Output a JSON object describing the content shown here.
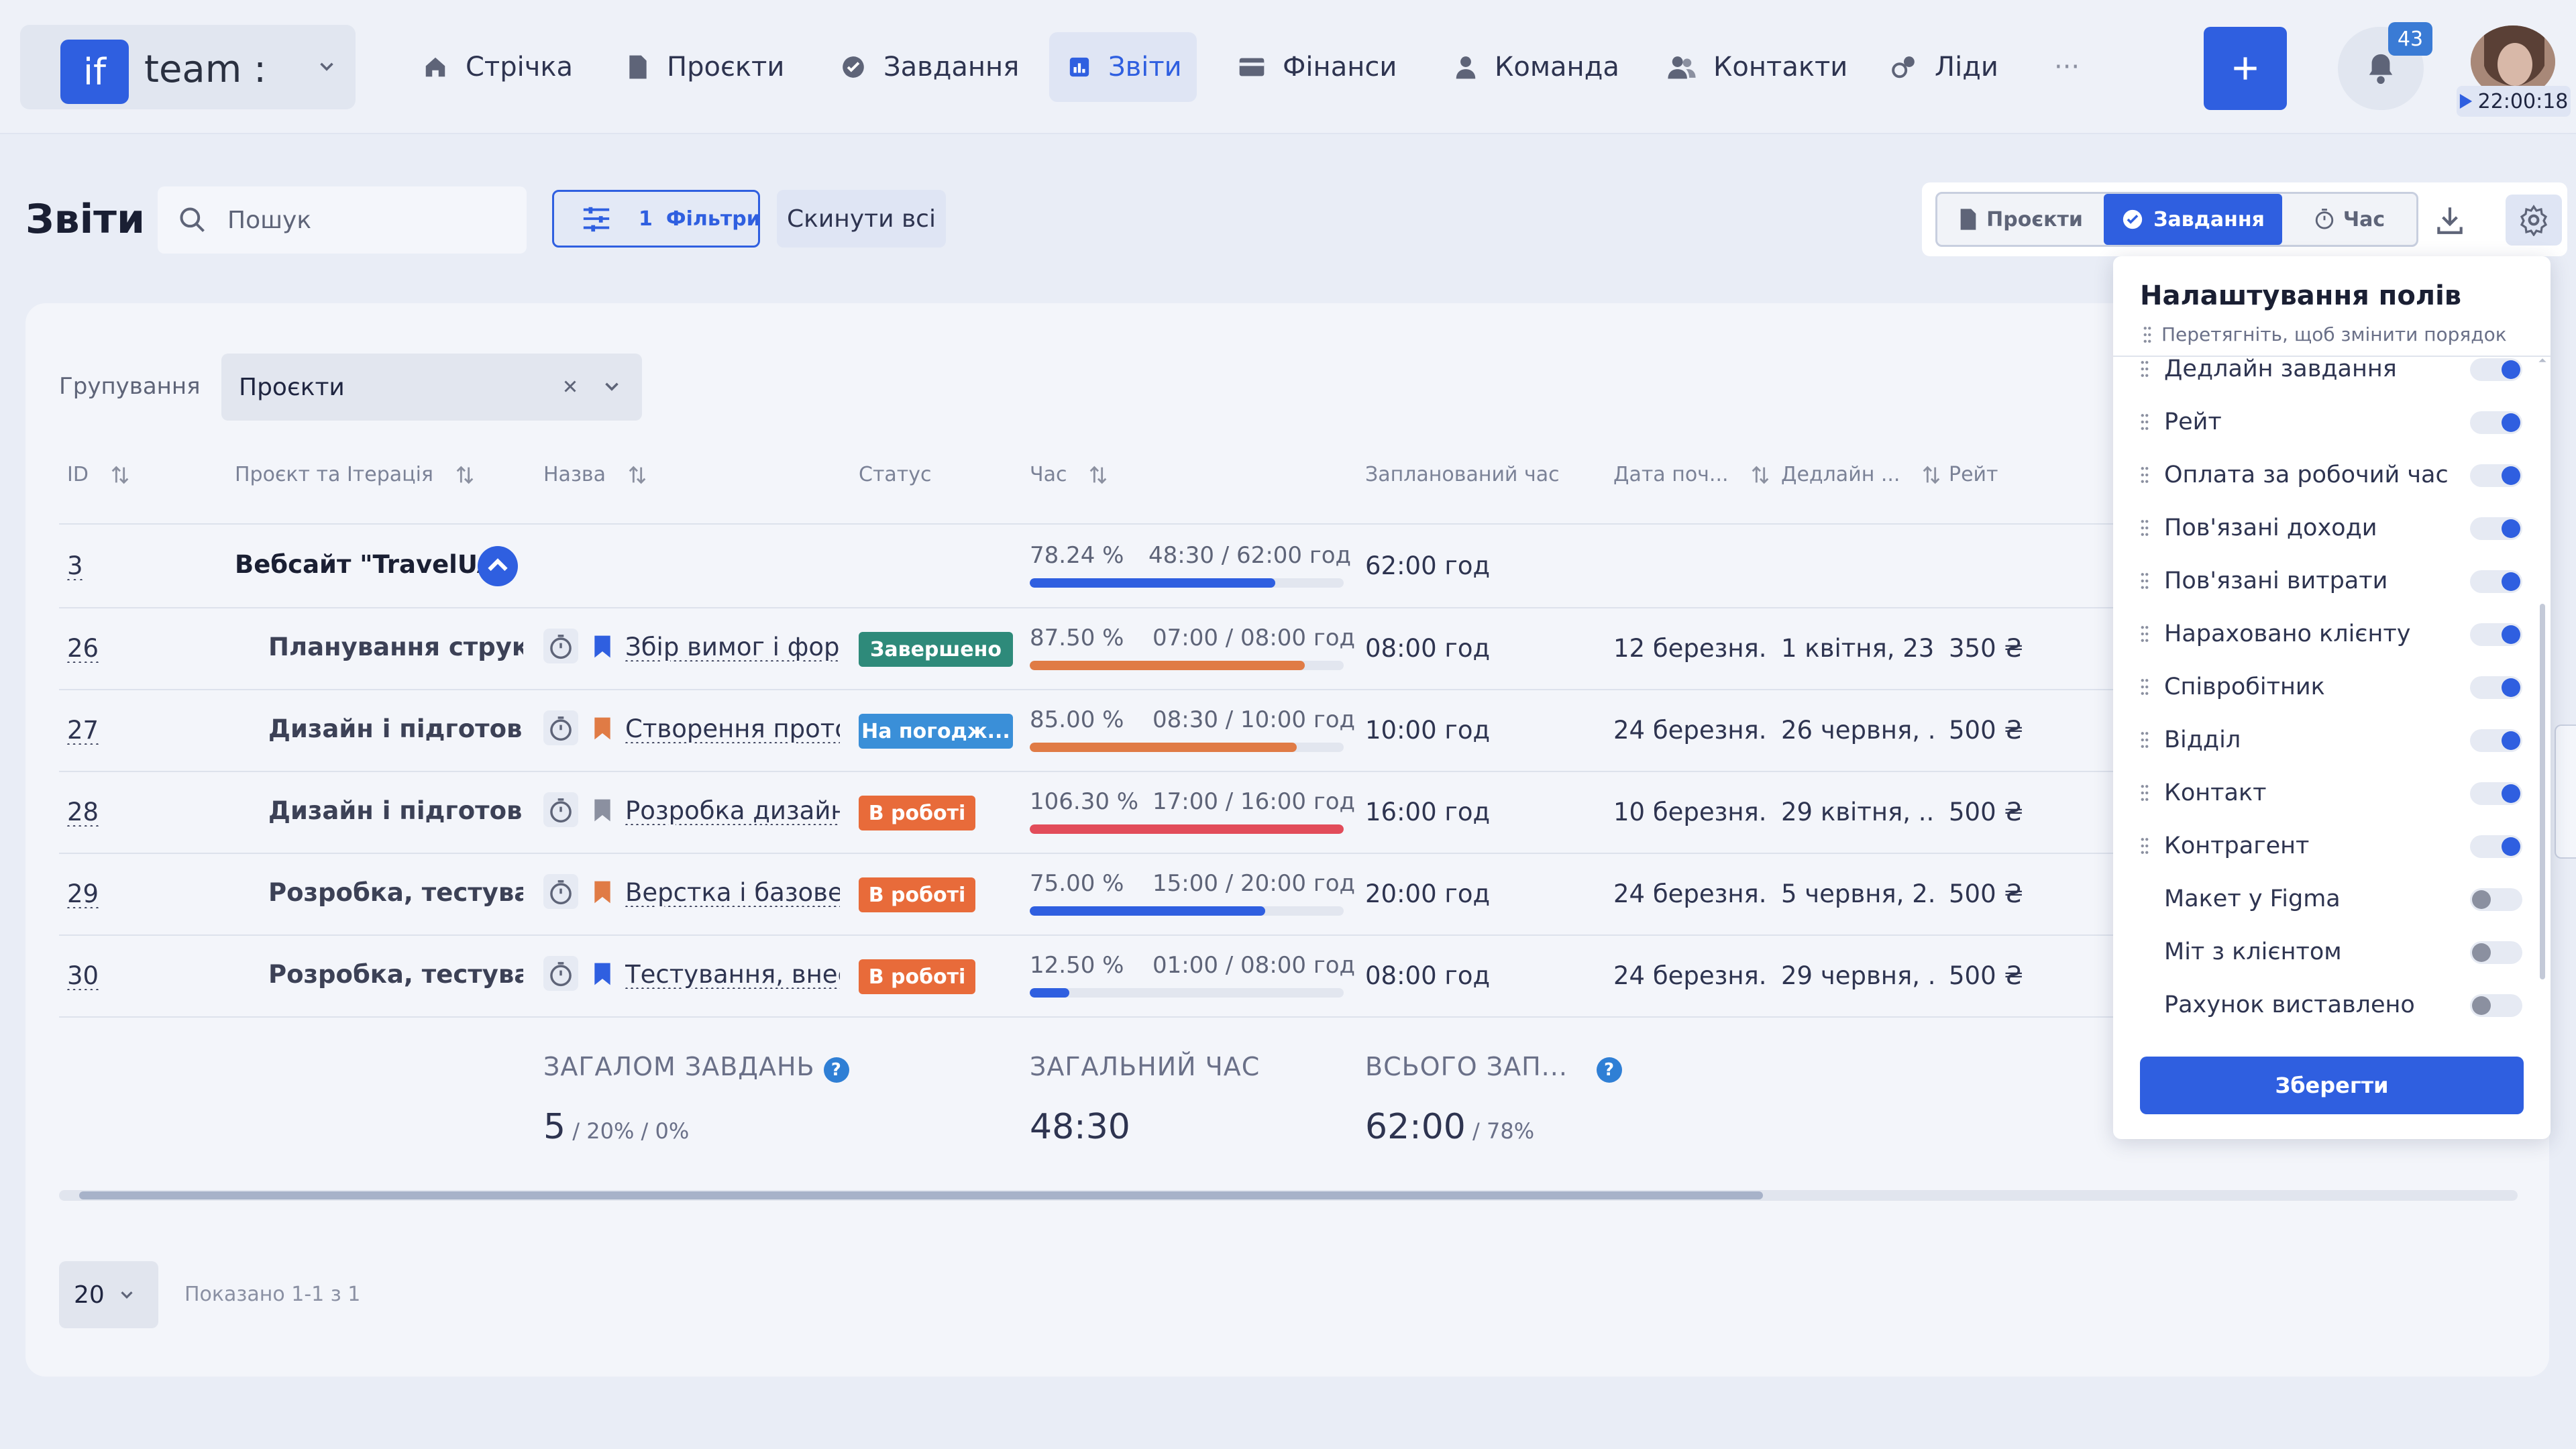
{
  "brand": {
    "logo_text": "if",
    "name": "team :"
  },
  "nav": {
    "items": [
      {
        "label": "Стрічка",
        "icon": "home-icon"
      },
      {
        "label": "Проєкти",
        "icon": "document-icon"
      },
      {
        "label": "Завдання",
        "icon": "check-circle-icon"
      },
      {
        "label": "Звіти",
        "icon": "chart-icon",
        "active": true
      },
      {
        "label": "Фінанси",
        "icon": "card-icon"
      },
      {
        "label": "Команда",
        "icon": "person-icon"
      },
      {
        "label": "Контакти",
        "icon": "contacts-icon"
      },
      {
        "label": "Ліди",
        "icon": "leads-icon"
      }
    ],
    "more": "···",
    "notifications_count": "43",
    "timer": "22:00:18"
  },
  "toolbar": {
    "title": "Звіти",
    "search_placeholder": "Пошук",
    "filters_count": "1",
    "filters_label": "Фільтри",
    "reset_label": "Скинути всі",
    "segments": [
      "Проєкти",
      "Завдання",
      "Час"
    ],
    "active_segment": "Завдання"
  },
  "grouping": {
    "label": "Групування",
    "value": "Проєкти"
  },
  "table": {
    "headers": {
      "id": "ID",
      "project": "Проєкт та Ітерація",
      "name": "Назва",
      "status": "Статус",
      "time": "Час",
      "planned": "Запланований час",
      "start": "Дата поч...",
      "deadline": "Дедлайн ...",
      "rate": "Рейт"
    },
    "group": {
      "id": "3",
      "name": "Вебсайт \"TravelUA\"",
      "pct": "78.24 %",
      "time": "48:30 / 62:00 год",
      "progress": 0.7824,
      "planned": "62:00 год"
    },
    "rows": [
      {
        "id": "26",
        "project": "Планування структу...",
        "name": "Збір вимог і форм...",
        "flag": "#2f5fe0",
        "status": "Завершено",
        "status_color": "#2e8a7a",
        "pct": "87.50 %",
        "time": "07:00 / 08:00 год",
        "progress": 0.875,
        "bar_color": "#e07b45",
        "planned": "08:00 год",
        "start": "12 березня...",
        "deadline": "1 квітня, 23...",
        "rate": "350 ₴"
      },
      {
        "id": "27",
        "project": "Дизайн і підготовка ...",
        "name": "Створення прото...",
        "flag": "#e07b45",
        "status": "На погодж...",
        "status_color": "#3a8fd8",
        "pct": "85.00 %",
        "time": "08:30 / 10:00 год",
        "progress": 0.85,
        "bar_color": "#e07b45",
        "planned": "10:00 год",
        "start": "24 березня...",
        "deadline": "26 червня, ...",
        "rate": "500 ₴"
      },
      {
        "id": "28",
        "project": "Дизайн і підготовка ...",
        "name": "Розробка дизайн...",
        "flag": "#8b90a0",
        "status": "В роботі",
        "status_color": "#e86b3a",
        "pct": "106.30 %",
        "time": "17:00 / 16:00 год",
        "progress": 1.0,
        "bar_color": "#e24c5a",
        "planned": "16:00 год",
        "start": "10 березня...",
        "deadline": "29 квітня, ...",
        "rate": "500 ₴"
      },
      {
        "id": "29",
        "project": "Розробка, тестуван...",
        "name": "Верстка і базове ...",
        "flag": "#e07b45",
        "status": "В роботі",
        "status_color": "#e86b3a",
        "pct": "75.00 %",
        "time": "15:00 / 20:00 год",
        "progress": 0.75,
        "bar_color": "#2f5fe0",
        "planned": "20:00 год",
        "start": "24 березня...",
        "deadline": "5 червня, 2...",
        "rate": "500 ₴"
      },
      {
        "id": "30",
        "project": "Розробка, тестуван...",
        "name": "Тестування, внес...",
        "flag": "#2f5fe0",
        "status": "В роботі",
        "status_color": "#e86b3a",
        "pct": "12.50 %",
        "time": "01:00 / 08:00 год",
        "progress": 0.125,
        "bar_color": "#2f5fe0",
        "planned": "08:00 год",
        "start": "24 березня...",
        "deadline": "29 червня, ...",
        "rate": "500 ₴"
      }
    ]
  },
  "summary": {
    "tasks_label": "ЗАГАЛОМ ЗАВДАНЬ",
    "tasks_value": "5",
    "tasks_sub": " / 20% / 0%",
    "time_label": "ЗАГАЛЬНИЙ ЧАС",
    "time_value": "48:30",
    "planned_label": "ВСЬОГО ЗАП...",
    "planned_value": "62:00",
    "planned_sub": " / 78%"
  },
  "pagination": {
    "page_size": "20",
    "shown": "Показано 1-1 з 1"
  },
  "popup": {
    "title": "Налаштування полів",
    "subtitle": "Перетягніть, щоб змінити порядок",
    "fields": [
      {
        "label": "Дедлайн завдання",
        "on": true,
        "drag": true
      },
      {
        "label": "Рейт",
        "on": true,
        "drag": true
      },
      {
        "label": "Оплата за робочий час",
        "on": true,
        "drag": true
      },
      {
        "label": "Пов'язані доходи",
        "on": true,
        "drag": true
      },
      {
        "label": "Пов'язані витрати",
        "on": true,
        "drag": true
      },
      {
        "label": "Нараховано клієнту",
        "on": true,
        "drag": true
      },
      {
        "label": "Співробітник",
        "on": true,
        "drag": true
      },
      {
        "label": "Відділ",
        "on": true,
        "drag": true
      },
      {
        "label": "Контакт",
        "on": true,
        "drag": true
      },
      {
        "label": "Контрагент",
        "on": true,
        "drag": true
      },
      {
        "label": "Макет у Figma",
        "on": false,
        "drag": false
      },
      {
        "label": "Міт з клієнтом",
        "on": false,
        "drag": false
      },
      {
        "label": "Рахунок виставлено",
        "on": false,
        "drag": false
      }
    ],
    "save_label": "Зберегти"
  },
  "colors": {
    "accent": "#2f5fe0",
    "background": "#e9edf6"
  }
}
